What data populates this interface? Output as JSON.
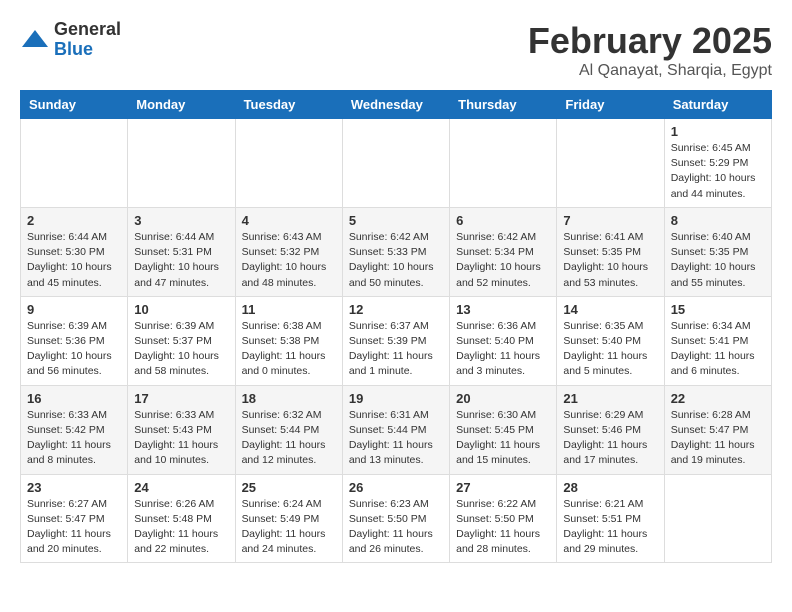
{
  "logo": {
    "general": "General",
    "blue": "Blue"
  },
  "title": "February 2025",
  "subtitle": "Al Qanayat, Sharqia, Egypt",
  "days": [
    "Sunday",
    "Monday",
    "Tuesday",
    "Wednesday",
    "Thursday",
    "Friday",
    "Saturday"
  ],
  "weeks": [
    [
      {
        "num": "",
        "info": ""
      },
      {
        "num": "",
        "info": ""
      },
      {
        "num": "",
        "info": ""
      },
      {
        "num": "",
        "info": ""
      },
      {
        "num": "",
        "info": ""
      },
      {
        "num": "",
        "info": ""
      },
      {
        "num": "1",
        "info": "Sunrise: 6:45 AM\nSunset: 5:29 PM\nDaylight: 10 hours and 44 minutes."
      }
    ],
    [
      {
        "num": "2",
        "info": "Sunrise: 6:44 AM\nSunset: 5:30 PM\nDaylight: 10 hours and 45 minutes."
      },
      {
        "num": "3",
        "info": "Sunrise: 6:44 AM\nSunset: 5:31 PM\nDaylight: 10 hours and 47 minutes."
      },
      {
        "num": "4",
        "info": "Sunrise: 6:43 AM\nSunset: 5:32 PM\nDaylight: 10 hours and 48 minutes."
      },
      {
        "num": "5",
        "info": "Sunrise: 6:42 AM\nSunset: 5:33 PM\nDaylight: 10 hours and 50 minutes."
      },
      {
        "num": "6",
        "info": "Sunrise: 6:42 AM\nSunset: 5:34 PM\nDaylight: 10 hours and 52 minutes."
      },
      {
        "num": "7",
        "info": "Sunrise: 6:41 AM\nSunset: 5:35 PM\nDaylight: 10 hours and 53 minutes."
      },
      {
        "num": "8",
        "info": "Sunrise: 6:40 AM\nSunset: 5:35 PM\nDaylight: 10 hours and 55 minutes."
      }
    ],
    [
      {
        "num": "9",
        "info": "Sunrise: 6:39 AM\nSunset: 5:36 PM\nDaylight: 10 hours and 56 minutes."
      },
      {
        "num": "10",
        "info": "Sunrise: 6:39 AM\nSunset: 5:37 PM\nDaylight: 10 hours and 58 minutes."
      },
      {
        "num": "11",
        "info": "Sunrise: 6:38 AM\nSunset: 5:38 PM\nDaylight: 11 hours and 0 minutes."
      },
      {
        "num": "12",
        "info": "Sunrise: 6:37 AM\nSunset: 5:39 PM\nDaylight: 11 hours and 1 minute."
      },
      {
        "num": "13",
        "info": "Sunrise: 6:36 AM\nSunset: 5:40 PM\nDaylight: 11 hours and 3 minutes."
      },
      {
        "num": "14",
        "info": "Sunrise: 6:35 AM\nSunset: 5:40 PM\nDaylight: 11 hours and 5 minutes."
      },
      {
        "num": "15",
        "info": "Sunrise: 6:34 AM\nSunset: 5:41 PM\nDaylight: 11 hours and 6 minutes."
      }
    ],
    [
      {
        "num": "16",
        "info": "Sunrise: 6:33 AM\nSunset: 5:42 PM\nDaylight: 11 hours and 8 minutes."
      },
      {
        "num": "17",
        "info": "Sunrise: 6:33 AM\nSunset: 5:43 PM\nDaylight: 11 hours and 10 minutes."
      },
      {
        "num": "18",
        "info": "Sunrise: 6:32 AM\nSunset: 5:44 PM\nDaylight: 11 hours and 12 minutes."
      },
      {
        "num": "19",
        "info": "Sunrise: 6:31 AM\nSunset: 5:44 PM\nDaylight: 11 hours and 13 minutes."
      },
      {
        "num": "20",
        "info": "Sunrise: 6:30 AM\nSunset: 5:45 PM\nDaylight: 11 hours and 15 minutes."
      },
      {
        "num": "21",
        "info": "Sunrise: 6:29 AM\nSunset: 5:46 PM\nDaylight: 11 hours and 17 minutes."
      },
      {
        "num": "22",
        "info": "Sunrise: 6:28 AM\nSunset: 5:47 PM\nDaylight: 11 hours and 19 minutes."
      }
    ],
    [
      {
        "num": "23",
        "info": "Sunrise: 6:27 AM\nSunset: 5:47 PM\nDaylight: 11 hours and 20 minutes."
      },
      {
        "num": "24",
        "info": "Sunrise: 6:26 AM\nSunset: 5:48 PM\nDaylight: 11 hours and 22 minutes."
      },
      {
        "num": "25",
        "info": "Sunrise: 6:24 AM\nSunset: 5:49 PM\nDaylight: 11 hours and 24 minutes."
      },
      {
        "num": "26",
        "info": "Sunrise: 6:23 AM\nSunset: 5:50 PM\nDaylight: 11 hours and 26 minutes."
      },
      {
        "num": "27",
        "info": "Sunrise: 6:22 AM\nSunset: 5:50 PM\nDaylight: 11 hours and 28 minutes."
      },
      {
        "num": "28",
        "info": "Sunrise: 6:21 AM\nSunset: 5:51 PM\nDaylight: 11 hours and 29 minutes."
      },
      {
        "num": "",
        "info": ""
      }
    ]
  ]
}
